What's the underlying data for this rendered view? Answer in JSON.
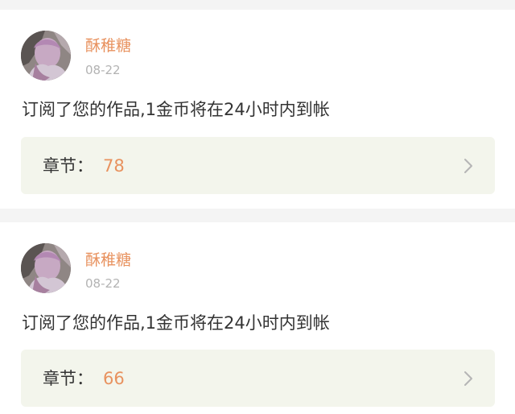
{
  "notifications": [
    {
      "username": "酥稚糖",
      "date": "08-22",
      "message": "订阅了您的作品,1金币将在24小时内到帐",
      "chapter_label": "章节：",
      "chapter_value": "78"
    },
    {
      "username": "酥稚糖",
      "date": "08-22",
      "message": "订阅了您的作品,1金币将在24小时内到帐",
      "chapter_label": "章节：",
      "chapter_value": "66"
    }
  ],
  "icons": {
    "chevron": "chevron-right-icon"
  },
  "colors": {
    "accent": "#e8925f",
    "page_background": "#f4f4f4",
    "chapter_box_background": "#f3f5ec",
    "text": "#333333",
    "muted": "#b3b3b3"
  }
}
